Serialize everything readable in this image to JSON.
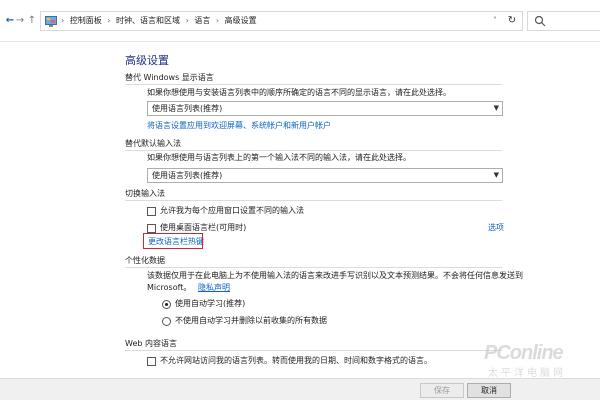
{
  "breadcrumb": {
    "items": [
      "控制面板",
      "时钟、语言和区域",
      "语言",
      "高级设置"
    ]
  },
  "page": {
    "title": "高级设置"
  },
  "override_display_language": {
    "heading": "替代 Windows 显示语言",
    "description": "如果你想使用与安装语言列表中的顺序所确定的语言不同的显示语言，请在此处选择。",
    "select_value": "使用语言列表(推荐)",
    "apply_link": "将语言设置应用到欢迎屏幕、系统帐户和新用户帐户"
  },
  "override_input_method": {
    "heading": "替代默认输入法",
    "description": "如果你想使用与语言列表上的第一个输入法不同的输入法，请在此处选择。",
    "select_value": "使用语言列表(推荐)"
  },
  "switch_input": {
    "heading": "切换输入法",
    "checkbox1": "允许我为每个应用窗口设置不同的输入法",
    "checkbox2": "使用桌面语言栏(可用时)",
    "options_link": "选项",
    "hotkeys_link": "更改语言栏热键"
  },
  "personalization": {
    "heading": "个性化数据",
    "description_line1": "该数据仅用于在此电脑上为不使用输入法的语言来改进手写识别以及文本预测结果。不会将任何信息发送到",
    "description_line2": "Microsoft。",
    "privacy_link": "隐私声明",
    "radio1": "使用自动学习(推荐)",
    "radio2": "不使用自动学习并删除以前收集的所有数据"
  },
  "web_content": {
    "heading": "Web 内容语言",
    "checkbox": "不允许网站访问我的语言列表。转而使用我的日期、时间和数字格式的语言。"
  },
  "footer": {
    "save_label": "保存",
    "cancel_label": "取消"
  },
  "watermark": {
    "main": "PConline",
    "sub": "太平洋电脑网"
  },
  "state": {
    "radio_selected": "radio1"
  },
  "colors": {
    "title": "#1e3287",
    "link": "#0b63c4",
    "highlight": "#d0262e"
  }
}
